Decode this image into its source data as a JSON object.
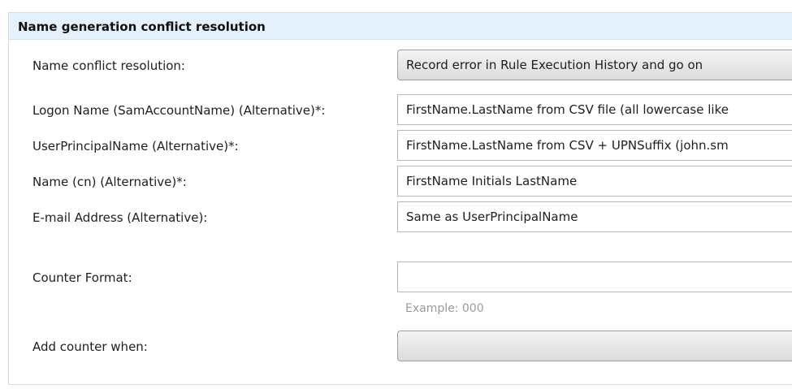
{
  "section": {
    "title": "Name generation conflict resolution"
  },
  "rows": [
    {
      "label": "Name conflict resolution:",
      "value": "Record error in Rule Execution History and go on",
      "kind": "dropdown"
    },
    {
      "label": "Logon Name (SamAccountName) (Alternative)*:",
      "value": "FirstName.LastName from CSV file (all lowercase like",
      "kind": "text"
    },
    {
      "label": "UserPrincipalName (Alternative)*:",
      "value": "FirstName.LastName from CSV + UPNSuffix (john.sm",
      "kind": "text"
    },
    {
      "label": "Name (cn) (Alternative)*:",
      "value": "FirstName Initials LastName",
      "kind": "text"
    },
    {
      "label": "E-mail Address (Alternative):",
      "value": "Same as UserPrincipalName",
      "kind": "text"
    },
    {
      "label": "Counter Format:",
      "value": "",
      "kind": "input",
      "hint": "Example: 000"
    },
    {
      "label": "Add counter when:",
      "value": "",
      "kind": "dropdown"
    }
  ],
  "colors": {
    "header_background": "#e4f0fb",
    "hint_text": "#9a9a9a",
    "dropdown_gradient_top": "#f3f3f3",
    "dropdown_gradient_bottom": "#dcdcdc"
  }
}
